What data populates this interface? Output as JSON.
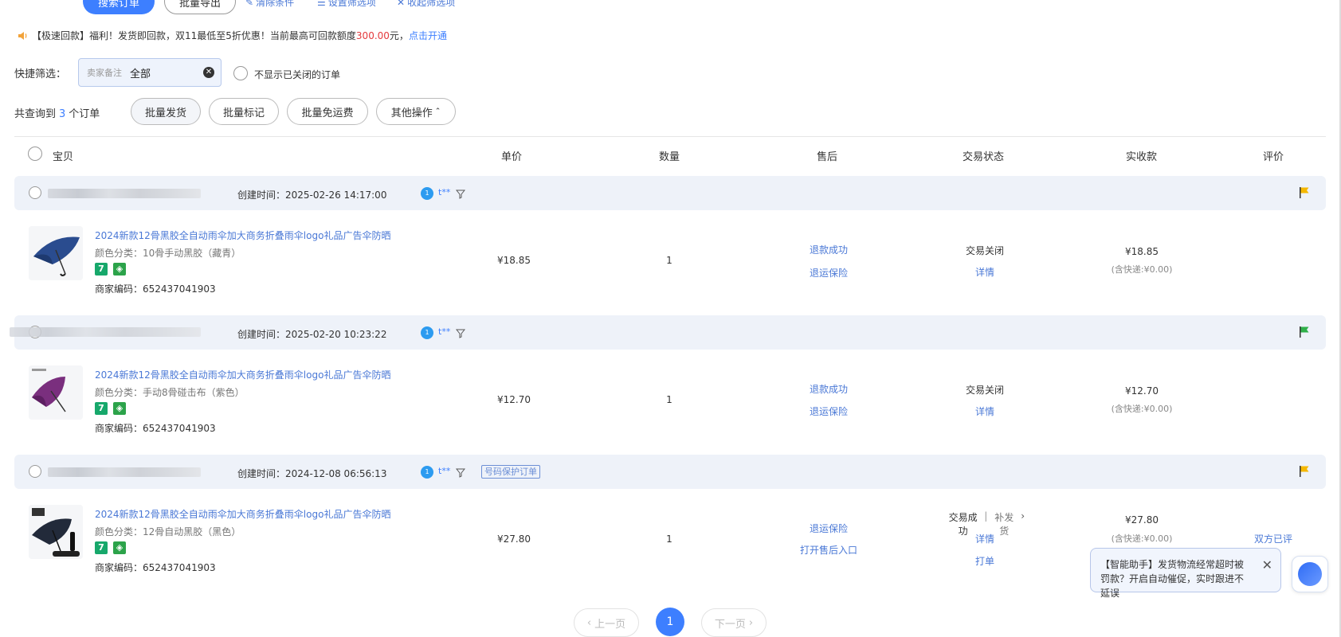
{
  "toolbar": {
    "search_label": "搜索订单",
    "export_label": "批量导出",
    "clear_label": "清除条件",
    "setting_label": "设置筛选项",
    "collapse_label": "收起筛选项"
  },
  "notice": {
    "prefix": "【极速回款】福利！发货即回款，双11最低至5折优惠！当前最高可回款额度",
    "amount": "300.00",
    "suffix": "元，",
    "link": "点击开通"
  },
  "quick_filter": {
    "label": "快捷筛选：",
    "placeholder": "卖家备注",
    "value": "全部",
    "hide_closed_label": "不显示已关闭的订单"
  },
  "summary": {
    "prefix": "共查询到",
    "count": "3",
    "suffix": "个订单"
  },
  "batch_actions": {
    "ship": "批量发货",
    "mark": "批量标记",
    "free_shipping": "批量免运费",
    "more": "其他操作"
  },
  "columns": [
    "宝贝",
    "单价",
    "数量",
    "售后",
    "交易状态",
    "实收款",
    "评价"
  ],
  "orders": [
    {
      "created": "创建时间：2025-02-26 14:17:00",
      "badge": "1",
      "user": "t**",
      "flag_color": "#f5b800",
      "product_title": "2024新款12骨黑胶全自动雨伞加大商务折叠雨伞logo礼品广告伞防晒",
      "spec": "颜色分类：10骨手动黑胶（藏青）",
      "code": "商家编码：652437041903",
      "price": "¥18.85",
      "qty": "1",
      "after_sale": [
        "退款成功",
        "退运保险"
      ],
      "status": "交易关闭",
      "status_link": "详情",
      "paid": "¥18.85",
      "paid_note": "(含快递:¥0.00)",
      "review": "",
      "umbrella_color": "#2a4c8f"
    },
    {
      "created": "创建时间：2025-02-20 10:23:22",
      "badge": "1",
      "user": "t**",
      "flag_color": "#2fb04a",
      "product_title": "2024新款12骨黑胶全自动雨伞加大商务折叠雨伞logo礼品广告伞防晒",
      "spec": "颜色分类：手动8骨碰击布（紫色）",
      "code": "商家编码：652437041903",
      "price": "¥12.70",
      "qty": "1",
      "after_sale": [
        "退款成功",
        "退运保险"
      ],
      "status": "交易关闭",
      "status_link": "详情",
      "paid": "¥12.70",
      "paid_note": "(含快递:¥0.00)",
      "review": "",
      "umbrella_color": "#7a2f7e"
    },
    {
      "created": "创建时间：2024-12-08 06:56:13",
      "badge": "1",
      "user": "t**",
      "protect": "号码保护订单",
      "flag_color": "#f5b800",
      "product_title": "2024新款12骨黑胶全自动雨伞加大商务折叠雨伞logo礼品广告伞防晒",
      "spec": "颜色分类：12骨自动黑胶（黑色）",
      "code": "商家编码：652437041903",
      "price": "¥27.80",
      "qty": "1",
      "after_sale": [
        "退运保险",
        "打开售后入口"
      ],
      "status": "交易成功",
      "status_extra": "补发货",
      "status_link": "详情",
      "status_link2": "打单",
      "paid": "¥27.80",
      "paid_note": "(含快递:¥0.00)",
      "review": "双方已评",
      "umbrella_color": "#222a3a"
    }
  ],
  "pager": {
    "prev": "上一页",
    "current": "1",
    "next": "下一页"
  },
  "assistant": {
    "tip": "【智能助手】发货物流经常超时被罚款？开启自动催促，实时跟进不延误"
  },
  "colors": {
    "primary": "#3d7fff",
    "link": "#4a78d6",
    "price_red": "#e4393c"
  }
}
